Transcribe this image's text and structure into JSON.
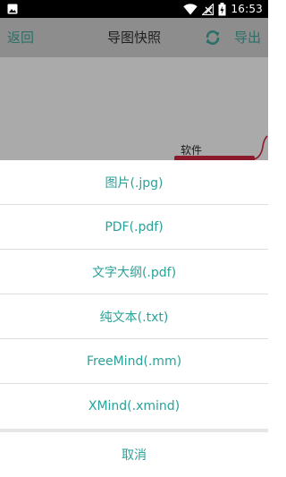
{
  "status_bar": {
    "time": "16:53",
    "icons": [
      "image-icon",
      "wifi-icon",
      "signal-icon",
      "battery-icon"
    ]
  },
  "header": {
    "back_label": "返回",
    "title": "导图快照",
    "refresh_icon": "refresh-icon",
    "export_label": "导出"
  },
  "canvas": {
    "node_label": "软件"
  },
  "export_sheet": {
    "options": [
      "图片(.jpg)",
      "PDF(.pdf)",
      "文字大纲(.pdf)",
      "纯文本(.txt)",
      "FreeMind(.mm)",
      "XMind(.xmind)"
    ],
    "cancel_label": "取消"
  },
  "colors": {
    "accent": "#2aa198",
    "header_link": "#2c6f68",
    "overlay": "#aaaaaa",
    "node_bar": "#8a1a2c"
  }
}
